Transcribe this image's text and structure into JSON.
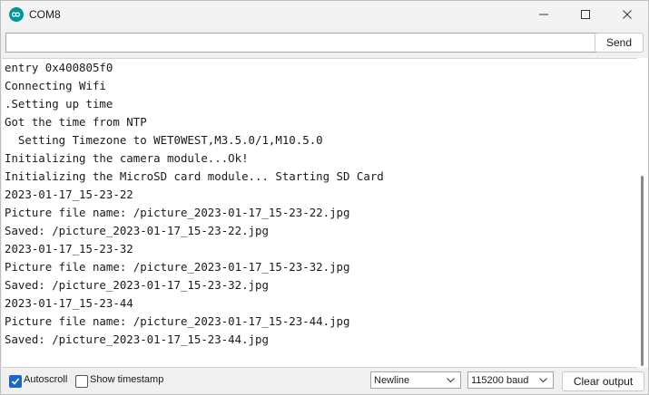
{
  "window": {
    "title": "COM8",
    "icon": "arduino-infinity-icon"
  },
  "send_row": {
    "input_value": "",
    "send_label": "Send"
  },
  "output": {
    "lines": [
      "entry 0x400805f0",
      "Connecting Wifi",
      ".Setting up time",
      "Got the time from NTP",
      "  Setting Timezone to WET0WEST,M3.5.0/1,M10.5.0",
      "Initializing the camera module...Ok!",
      "Initializing the MicroSD card module... Starting SD Card",
      "2023-01-17_15-23-22",
      "Picture file name: /picture_2023-01-17_15-23-22.jpg",
      "Saved: /picture_2023-01-17_15-23-22.jpg",
      "2023-01-17_15-23-32",
      "Picture file name: /picture_2023-01-17_15-23-32.jpg",
      "Saved: /picture_2023-01-17_15-23-32.jpg",
      "2023-01-17_15-23-44",
      "Picture file name: /picture_2023-01-17_15-23-44.jpg",
      "Saved: /picture_2023-01-17_15-23-44.jpg"
    ]
  },
  "footer": {
    "autoscroll_label": "Autoscroll",
    "autoscroll_checked": true,
    "timestamp_label": "Show timestamp",
    "timestamp_checked": false,
    "line_ending": "Newline",
    "baud_rate": "115200 baud",
    "clear_label": "Clear output"
  },
  "colors": {
    "accent": "#1967c9",
    "arduino": "#00979c"
  }
}
